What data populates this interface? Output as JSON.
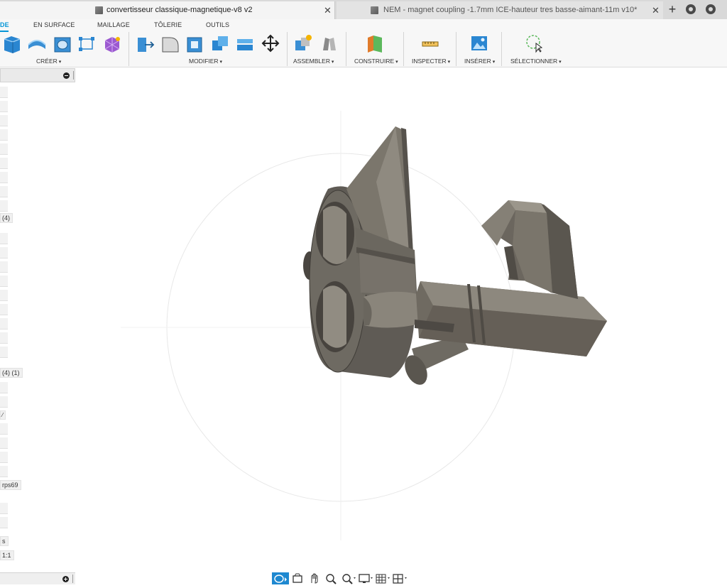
{
  "tabs": [
    {
      "title": "convertisseur classique-magnetique-v8 v2",
      "active": true
    },
    {
      "title": "NEM - magnet coupling -1.7mm ICE-hauteur tres basse-aimant-11m v10*",
      "active": false
    }
  ],
  "tab_close_glyph": "✕",
  "new_tab_glyph": "+",
  "workspace_tabs": [
    "DE",
    "EN SURFACE",
    "MAILLAGE",
    "TÔLERIE",
    "OUTILS"
  ],
  "tool_groups": [
    "CRÉER",
    "MODIFIER",
    "ASSEMBLER",
    "CONSTRUIRE",
    "INSPECTER",
    "INSÉRER",
    "SÉLECTIONNER"
  ],
  "browser": {
    "labels": [
      "(4)",
      "(4) (1)",
      "⁄",
      "rps69",
      "s",
      "1:1"
    ]
  },
  "colors": {
    "accent": "#0696d7",
    "model_body": "#6f6a61",
    "model_dark": "#4e4a44",
    "model_light": "#9a958b"
  },
  "icons": {
    "orbit": "orbit-icon",
    "look": "look-at-icon",
    "pan": "pan-icon",
    "zoom": "zoom-icon",
    "fit": "zoom-window-icon",
    "display": "display-settings-icon",
    "grid": "grid-icon",
    "viewports": "viewports-icon"
  }
}
